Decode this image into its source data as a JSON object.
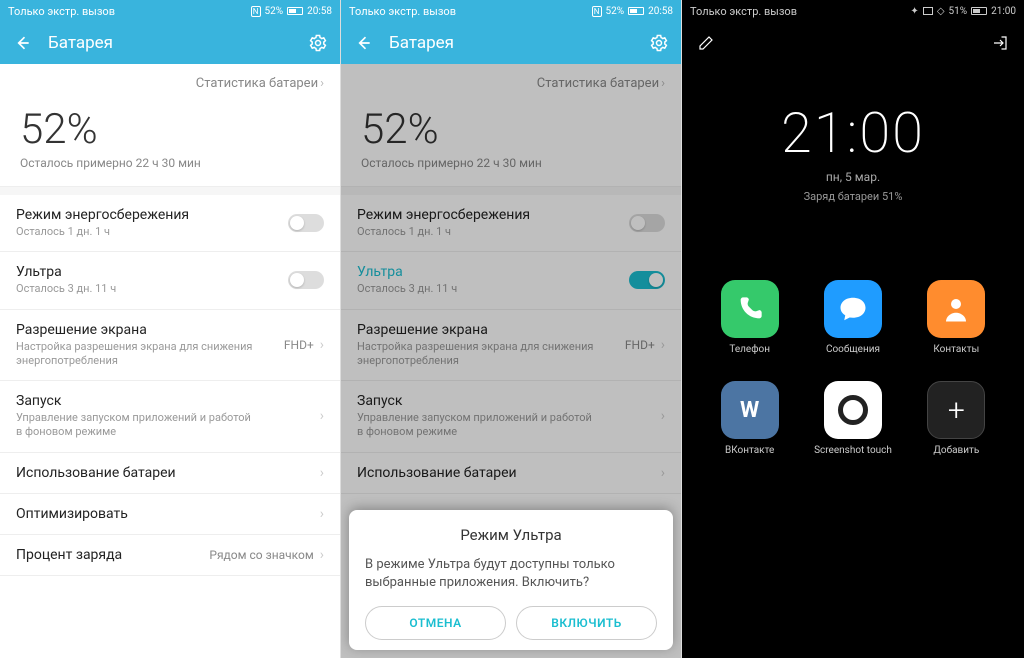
{
  "s1": {
    "status_left": "Только экстр. вызов",
    "status_pct": "52%",
    "status_time": "20:58",
    "nfc": "N",
    "header": "Батарея",
    "stats_link": "Статистика батареи",
    "pct": "52%",
    "pct_sub": "Осталось примерно 22 ч 30 мин",
    "items": [
      {
        "title": "Режим энергосбережения",
        "sub": "Осталось 1 дн. 1 ч"
      },
      {
        "title": "Ультра",
        "sub": "Осталось 3 дн. 11 ч"
      },
      {
        "title": "Разрешение экрана",
        "sub": "Настройка разрешения экрана для снижения энергопотребления",
        "val": "FHD+"
      },
      {
        "title": "Запуск",
        "sub": "Управление запуском приложений и работой в фоновом режиме"
      },
      {
        "title": "Использование батареи"
      },
      {
        "title": "Оптимизировать"
      },
      {
        "title": "Процент заряда",
        "val": "Рядом со значком"
      }
    ]
  },
  "s2": {
    "status_left": "Только экстр. вызов",
    "status_pct": "52%",
    "status_time": "20:58",
    "nfc": "N",
    "header": "Батарея",
    "stats_link": "Статистика батареи",
    "pct": "52%",
    "pct_sub": "Осталось примерно 22 ч 30 мин",
    "items": [
      {
        "title": "Режим энергосбережения",
        "sub": "Осталось 1 дн. 1 ч"
      },
      {
        "title": "Ультра",
        "sub": "Осталось 3 дн. 11 ч"
      },
      {
        "title": "Разрешение экрана",
        "sub": "Настройка разрешения экрана для снижения энергопотребления",
        "val": "FHD+"
      },
      {
        "title": "Запуск",
        "sub": "Управление запуском приложений и работой в фоновом режиме"
      },
      {
        "title": "Использование батареи"
      }
    ],
    "dialog": {
      "title": "Режим Ультра",
      "msg": "В режиме Ультра будут доступны только выбранные приложения. Включить?",
      "cancel": "ОТМЕНА",
      "ok": "ВКЛЮЧИТЬ"
    }
  },
  "s3": {
    "status_left": "Только экстр. вызов",
    "status_pct": "51%",
    "status_time": "21:00",
    "clock": "21:00",
    "date": "пн, 5 мар.",
    "charge": "Заряд батареи 51%",
    "apps": [
      {
        "label": "Телефон"
      },
      {
        "label": "Сообщения"
      },
      {
        "label": "Контакты"
      },
      {
        "label": "ВКонтакте"
      },
      {
        "label": "Screenshot touch"
      },
      {
        "label": "Добавить"
      }
    ]
  }
}
